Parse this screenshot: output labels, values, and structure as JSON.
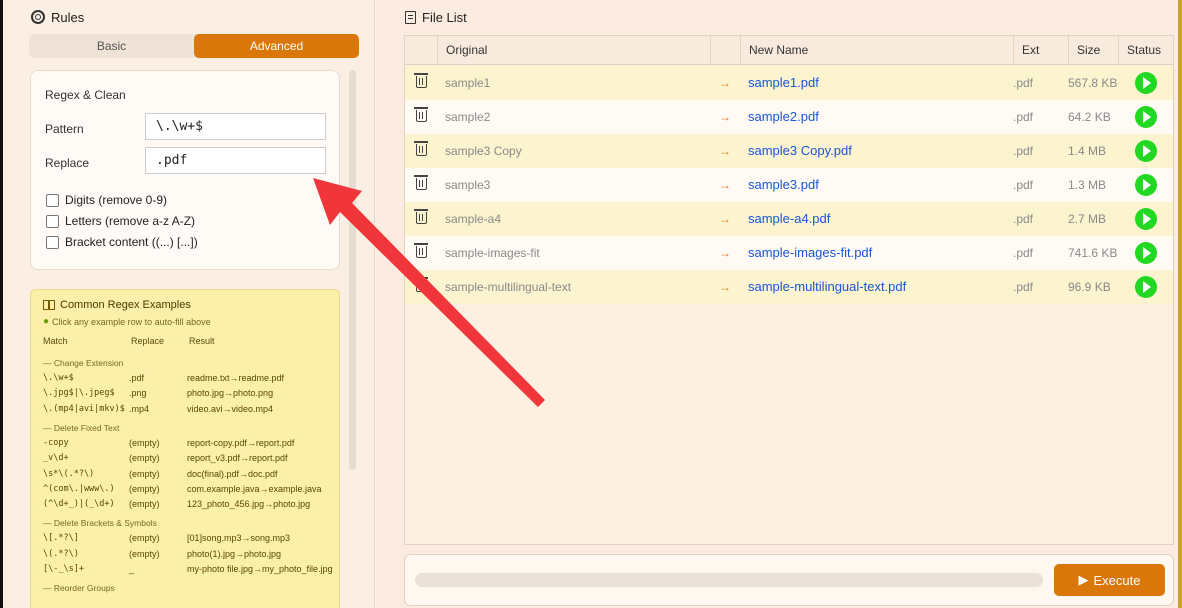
{
  "rules": {
    "title": "Rules",
    "modes": [
      "Basic",
      "Advanced"
    ],
    "active_mode": "Advanced",
    "regex_card": {
      "title": "Regex & Clean",
      "pattern_label": "Pattern",
      "pattern_value": "\\.\\w+$",
      "replace_label": "Replace",
      "replace_value": ".pdf",
      "checks": [
        "Digits (remove 0-9)",
        "Letters (remove a-z A-Z)",
        "Bracket content ((...) [...])"
      ]
    },
    "examples": {
      "title": "Common Regex Examples",
      "hint": "Click any example row to auto-fill above",
      "headers": [
        "Match",
        "Replace",
        "Result"
      ],
      "groups": [
        {
          "name": "— Change Extension",
          "rows": [
            [
              "\\.\\w+$",
              ".pdf",
              "readme.txt→readme.pdf"
            ],
            [
              "\\.jpg$|\\.jpeg$",
              ".png",
              "photo.jpg→photo.png"
            ],
            [
              "\\.(mp4|avi|mkv)$",
              ".mp4",
              "video.avi→video.mp4"
            ]
          ]
        },
        {
          "name": "— Delete Fixed Text",
          "rows": [
            [
              "-copy",
              "(empty)",
              "report-copy.pdf→report.pdf"
            ],
            [
              "_v\\d+",
              "(empty)",
              "report_v3.pdf→report.pdf"
            ],
            [
              "\\s*\\(.*?\\)",
              "(empty)",
              "doc(final).pdf→doc.pdf"
            ],
            [
              "^(com\\.|www\\.)",
              "(empty)",
              "com.example.java→example.java"
            ],
            [
              "(^\\d+_)|(_\\d+)",
              "(empty)",
              "123_photo_456.jpg→photo.jpg"
            ]
          ]
        },
        {
          "name": "— Delete Brackets & Symbols",
          "rows": [
            [
              "\\[.*?\\]",
              "(empty)",
              "[01]song.mp3→song.mp3"
            ],
            [
              "\\(.*?\\)",
              "(empty)",
              "photo(1).jpg→photo.jpg"
            ],
            [
              "[\\-_\\s]+",
              "_",
              "my-photo file.jpg→my_photo_file.jpg"
            ]
          ]
        },
        {
          "name": "— Reorder Groups",
          "rows": []
        }
      ]
    }
  },
  "file_list": {
    "title": "File List",
    "columns": [
      "Original",
      "",
      "New Name",
      "Ext",
      "Size",
      "Status"
    ],
    "rows": [
      {
        "original": "sample1",
        "arrow": "→",
        "new_name": "sample1.pdf",
        "ext": ".pdf",
        "size": "567.8 KB"
      },
      {
        "original": "sample2",
        "arrow": "→",
        "new_name": "sample2.pdf",
        "ext": ".pdf",
        "size": "64.2 KB"
      },
      {
        "original": "sample3 Copy",
        "arrow": "→",
        "new_name": "sample3 Copy.pdf",
        "ext": ".pdf",
        "size": "1.4 MB"
      },
      {
        "original": "sample3",
        "arrow": "→",
        "new_name": "sample3.pdf",
        "ext": ".pdf",
        "size": "1.3 MB"
      },
      {
        "original": "sample-a4",
        "arrow": "→",
        "new_name": "sample-a4.pdf",
        "ext": ".pdf",
        "size": "2.7 MB"
      },
      {
        "original": "sample-images-fit",
        "arrow": "→",
        "new_name": "sample-images-fit.pdf",
        "ext": ".pdf",
        "size": "741.6 KB"
      },
      {
        "original": "sample-multilingual-text",
        "arrow": "→",
        "new_name": "sample-multilingual-text.pdf",
        "ext": ".pdf",
        "size": "96.9 KB"
      }
    ],
    "progress": 0,
    "execute_label": "Execute"
  },
  "colors": {
    "accent": "#d9770b",
    "status_ok": "#22d822",
    "link": "#1a55d8",
    "annotation": "#f0363a"
  }
}
